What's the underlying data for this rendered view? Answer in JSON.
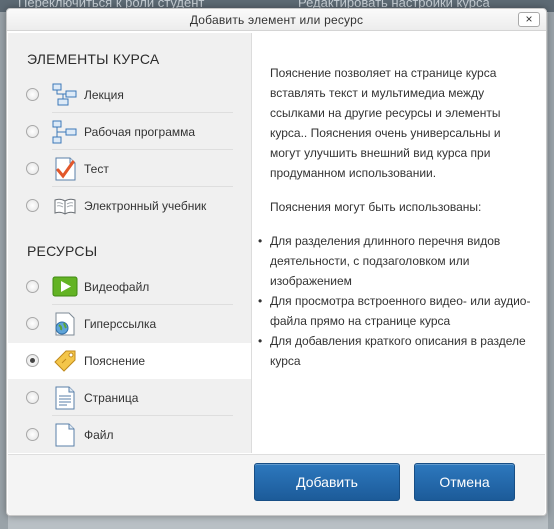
{
  "dialog": {
    "title": "Добавить элемент или ресурс",
    "close_label": "×"
  },
  "background": {
    "top_left_text": "Переключиться к роли студент",
    "top_right_text": "Редактировать настройки курса"
  },
  "sections": {
    "elements_title": "ЭЛЕМЕНТЫ КУРСА",
    "resources_title": "РЕСУРСЫ"
  },
  "elements": [
    {
      "label": "Лекция",
      "icon": "lesson-icon"
    },
    {
      "label": "Рабочая программа",
      "icon": "workflow-icon"
    },
    {
      "label": "Тест",
      "icon": "quiz-icon"
    },
    {
      "label": "Электронный учебник",
      "icon": "book-icon"
    }
  ],
  "resources": [
    {
      "label": "Видеофайл",
      "icon": "video-icon"
    },
    {
      "label": "Гиперссылка",
      "icon": "url-icon"
    },
    {
      "label": "Пояснение",
      "icon": "label-icon",
      "selected": true
    },
    {
      "label": "Страница",
      "icon": "page-icon"
    },
    {
      "label": "Файл",
      "icon": "file-icon"
    }
  ],
  "description": {
    "paragraph1": "Пояснение позволяет на странице курса вставлять текст и мультимедиа между ссылками на другие ресурсы и элементы курса.. Пояснения очень универсальны и могут улучшить внешний вид курса при продуманном использовании.",
    "paragraph2": "Пояснения могут быть использованы:",
    "bullets": [
      "Для разделения длинного перечня видов деятельности, с подзаголовком или изображением",
      "Для просмотра встроенного видео- или аудио-файла прямо на странице курса",
      "Для добавления краткого описания в разделе курса"
    ]
  },
  "buttons": {
    "add": "Добавить",
    "cancel": "Отмена"
  },
  "colors": {
    "primary_button": "#2d78be",
    "options_bg": "#f0f0f0"
  }
}
